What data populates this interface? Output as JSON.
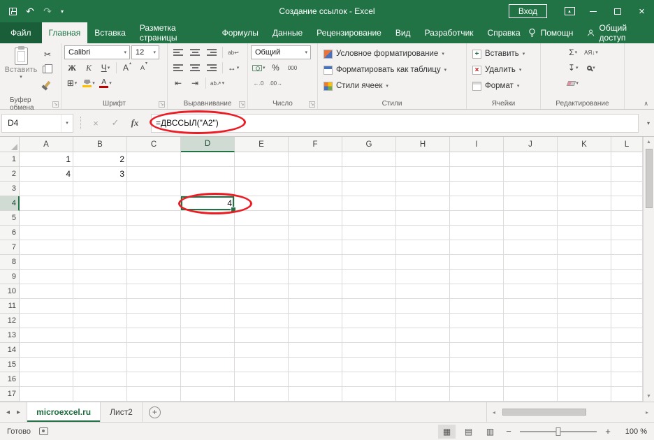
{
  "title_bar": {
    "title": "Создание ссылок - Excel",
    "sign_in": "Вход"
  },
  "ribbon_tabs": [
    {
      "label": "Файл"
    },
    {
      "label": "Главная"
    },
    {
      "label": "Вставка"
    },
    {
      "label": "Разметка страницы"
    },
    {
      "label": "Формулы"
    },
    {
      "label": "Данные"
    },
    {
      "label": "Рецензирование"
    },
    {
      "label": "Вид"
    },
    {
      "label": "Разработчик"
    },
    {
      "label": "Справка"
    }
  ],
  "tab_bar_right": {
    "assistant": "Помощн",
    "share": "Общий доступ"
  },
  "ribbon": {
    "clipboard": {
      "group_label": "Буфер обмена",
      "paste_label": "Вставить"
    },
    "font": {
      "group_label": "Шрифт",
      "font_name": "Calibri",
      "font_size": "12",
      "bold": "Ж",
      "italic": "К",
      "underline": "Ч"
    },
    "alignment": {
      "group_label": "Выравнивание"
    },
    "number": {
      "group_label": "Число",
      "format": "Общий",
      "percent": "%",
      "thousands": "000"
    },
    "styles": {
      "group_label": "Стили",
      "items": [
        {
          "label": "Условное форматирование"
        },
        {
          "label": "Форматировать как таблицу"
        },
        {
          "label": "Стили ячеек"
        }
      ]
    },
    "cells": {
      "group_label": "Ячейки",
      "items": [
        {
          "label": "Вставить"
        },
        {
          "label": "Удалить"
        },
        {
          "label": "Формат"
        }
      ]
    },
    "editing": {
      "group_label": "Редактирование"
    }
  },
  "formula_bar": {
    "name_box": "D4",
    "formula": "=ДВССЫЛ(\"A2\")"
  },
  "grid": {
    "columns": [
      "A",
      "B",
      "C",
      "D",
      "E",
      "F",
      "G",
      "H",
      "I",
      "J",
      "K",
      "L"
    ],
    "row_count": 17,
    "cells": [
      {
        "ref": "A1",
        "value": "1"
      },
      {
        "ref": "B1",
        "value": "2"
      },
      {
        "ref": "A2",
        "value": "4"
      },
      {
        "ref": "B2",
        "value": "3"
      },
      {
        "ref": "D4",
        "value": "4"
      }
    ],
    "selection": {
      "col": "D",
      "row": 4
    }
  },
  "sheet_bar": {
    "tabs": [
      {
        "label": "microexcel.ru",
        "active": true
      },
      {
        "label": "Лист2",
        "active": false
      }
    ]
  },
  "status_bar": {
    "mode": "Готово",
    "zoom_level": "100 %"
  },
  "colors": {
    "excel_green": "#217346",
    "annotation_red": "#ec1c24"
  },
  "icons": {
    "dropdown": "▾",
    "undo": "↶",
    "redo": "↷",
    "close": "×",
    "cancel": "×",
    "enter": "✓",
    "fx": "fx",
    "cut": "✂",
    "sigma": "Σ",
    "borders": "⊞",
    "letter_a": "А",
    "wrap": "ab↩",
    "merge": "↔",
    "indent_left": "⇤",
    "indent_right": "⇥",
    "orientation": "ab↗",
    "fill_down": "↧",
    "sort": "АЯ↓",
    "inc_decimal": "←.0",
    "dec_decimal": ".00→",
    "collapse_ribbon": "∧",
    "launcher": "↘",
    "up": "▲",
    "down": "▼",
    "left": "◂",
    "right": "▸",
    "view_normal": "▦",
    "view_layout": "▤",
    "view_break": "▥",
    "add_sheet": "+",
    "zoom_out": "−",
    "zoom_in": "+",
    "up_caret": "▴"
  }
}
